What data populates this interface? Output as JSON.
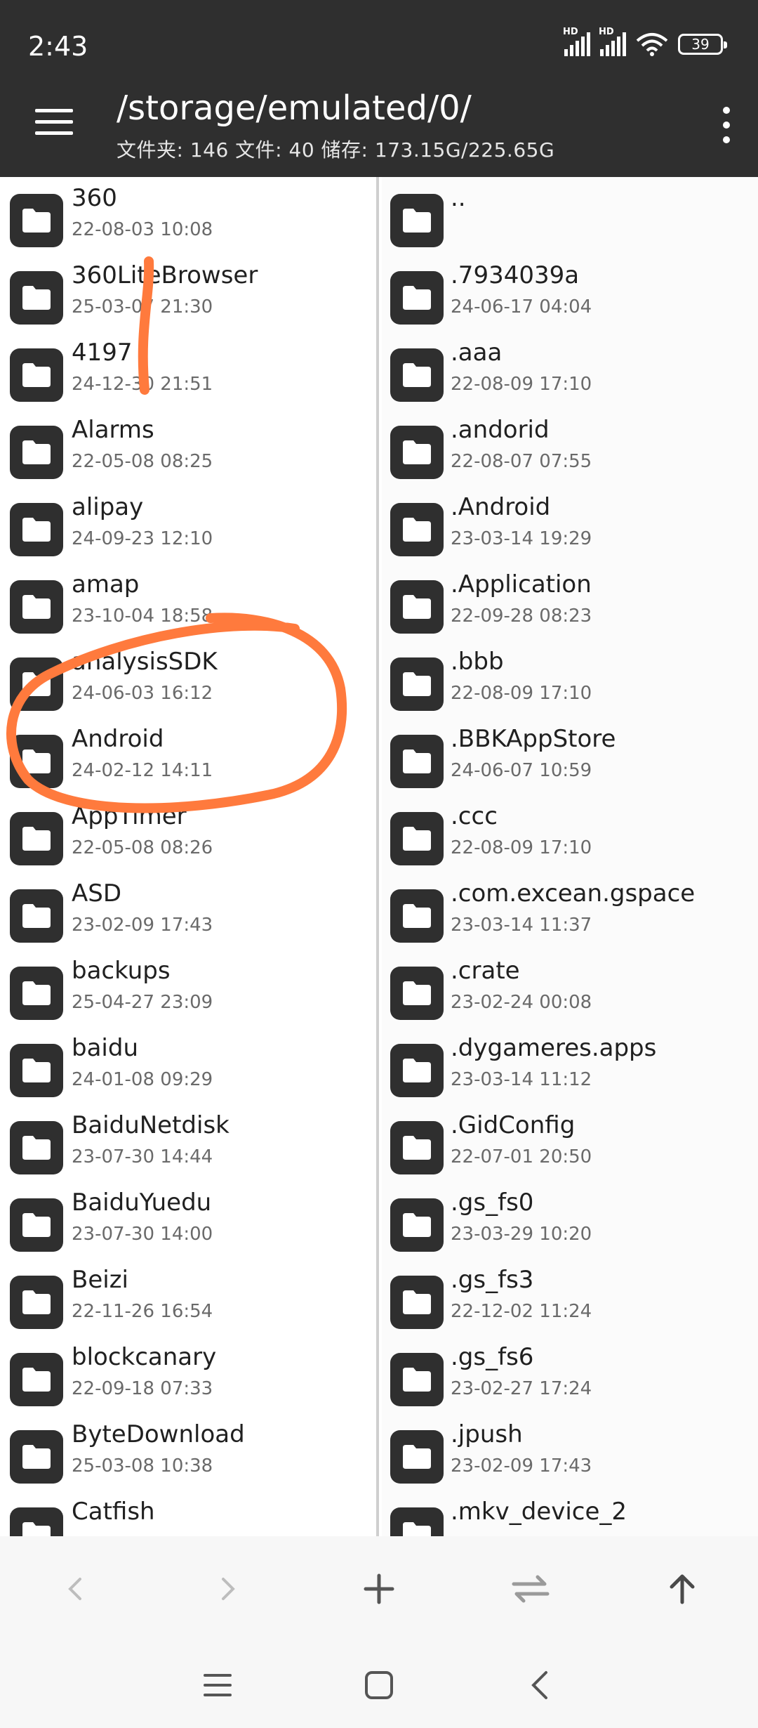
{
  "status_bar": {
    "time": "2:43",
    "hd1": "HD",
    "hd2": "HD",
    "battery": "39"
  },
  "header": {
    "path": "/storage/emulated/0/",
    "info": "文件夹: 146   文件: 40   储存: 173.15G/225.65G"
  },
  "left_pane": {
    "items": [
      {
        "name": "360",
        "date": "22-08-03 10:08"
      },
      {
        "name": "360LiteBrowser",
        "date": "25-03-07 21:30"
      },
      {
        "name": "4197",
        "date": "24-12-30 21:51"
      },
      {
        "name": "Alarms",
        "date": "22-05-08 08:25"
      },
      {
        "name": "alipay",
        "date": "24-09-23 12:10"
      },
      {
        "name": "amap",
        "date": "23-10-04 18:58"
      },
      {
        "name": "analysisSDK",
        "date": "24-06-03 16:12"
      },
      {
        "name": "Android",
        "date": "24-02-12 14:11"
      },
      {
        "name": "AppTimer",
        "date": "22-05-08 08:26"
      },
      {
        "name": "ASD",
        "date": "23-02-09 17:43"
      },
      {
        "name": "backups",
        "date": "25-04-27 23:09"
      },
      {
        "name": "baidu",
        "date": "24-01-08 09:29"
      },
      {
        "name": "BaiduNetdisk",
        "date": "23-07-30 14:44"
      },
      {
        "name": "BaiduYuedu",
        "date": "23-07-30 14:00"
      },
      {
        "name": "Beizi",
        "date": "22-11-26 16:54"
      },
      {
        "name": "blockcanary",
        "date": "22-09-18 07:33"
      },
      {
        "name": "ByteDownload",
        "date": "25-03-08 10:38"
      },
      {
        "name": "Catfish",
        "date": ""
      }
    ]
  },
  "right_pane": {
    "items": [
      {
        "name": "..",
        "date": ""
      },
      {
        "name": ".7934039a",
        "date": "24-06-17 04:04"
      },
      {
        "name": ".aaa",
        "date": "22-08-09 17:10"
      },
      {
        "name": ".andorid",
        "date": "22-08-07 07:55"
      },
      {
        "name": ".Android",
        "date": "23-03-14 19:29"
      },
      {
        "name": ".Application",
        "date": "22-09-28 08:23"
      },
      {
        "name": ".bbb",
        "date": "22-08-09 17:10"
      },
      {
        "name": ".BBKAppStore",
        "date": "24-06-07 10:59"
      },
      {
        "name": ".ccc",
        "date": "22-08-09 17:10"
      },
      {
        "name": ".com.excean.gspace",
        "date": "23-03-14 11:37"
      },
      {
        "name": ".crate",
        "date": "23-02-24 00:08"
      },
      {
        "name": ".dygameres.apps",
        "date": "23-03-14 11:12"
      },
      {
        "name": ".GidConfig",
        "date": "22-07-01 20:50"
      },
      {
        "name": ".gs_fs0",
        "date": "23-03-29 10:20"
      },
      {
        "name": ".gs_fs3",
        "date": "22-12-02 11:24"
      },
      {
        "name": ".gs_fs6",
        "date": "23-02-27 17:24"
      },
      {
        "name": ".jpush",
        "date": "23-02-09 17:43"
      },
      {
        "name": ".mkv_device_2",
        "date": ""
      }
    ]
  },
  "colors": {
    "appbar": "#2f2f2f",
    "annotation": "#ff7a3d",
    "icon_gray": "#9a9a9a",
    "icon_dark": "#4a4a4a"
  },
  "toolbar": {
    "icons": [
      "back-icon",
      "forward-icon",
      "add-icon",
      "swap-icon",
      "up-icon"
    ]
  },
  "system_nav": {
    "icons": [
      "menu-icon",
      "home-icon",
      "back-icon"
    ]
  }
}
